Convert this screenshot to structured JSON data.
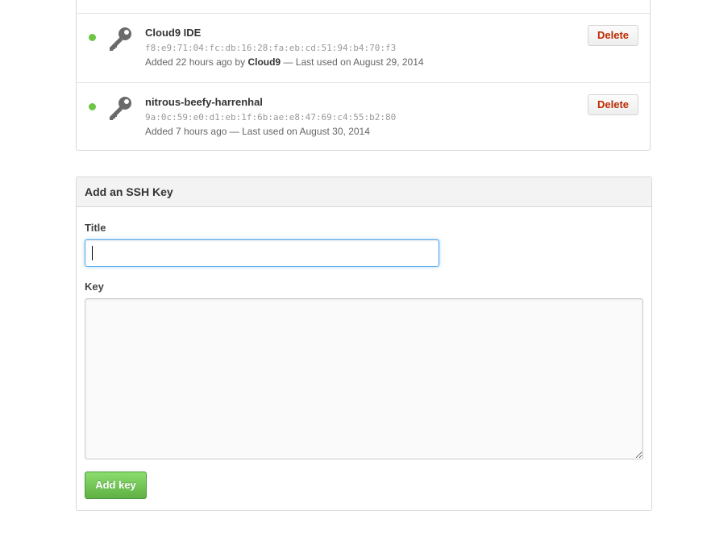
{
  "ssh_keys": [
    {
      "title": "Cloud9 IDE",
      "fingerprint": "f8:e9:71:04:fc:db:16:28:fa:eb:cd:51:94:b4:70:f3",
      "added_prefix": "Added 22 hours ago by ",
      "added_by": "Cloud9",
      "last_used": " — Last used on August 29, 2014",
      "status_color": "#6cc644",
      "icon": "key-icon",
      "delete_label": "Delete"
    },
    {
      "title": "nitrous-beefy-harrenhal",
      "fingerprint": "9a:0c:59:e0:d1:eb:1f:6b:ae:e8:47:69:c4:55:b2:80",
      "added_prefix": "Added 7 hours ago",
      "added_by": "",
      "last_used": " — Last used on August 30, 2014",
      "status_color": "#6cc644",
      "icon": "key-icon",
      "delete_label": "Delete"
    }
  ],
  "add_ssh_key": {
    "heading": "Add an SSH Key",
    "title_label": "Title",
    "title_value": "",
    "key_label": "Key",
    "key_value": "",
    "submit_label": "Add key",
    "submit_color": "#60b044"
  }
}
